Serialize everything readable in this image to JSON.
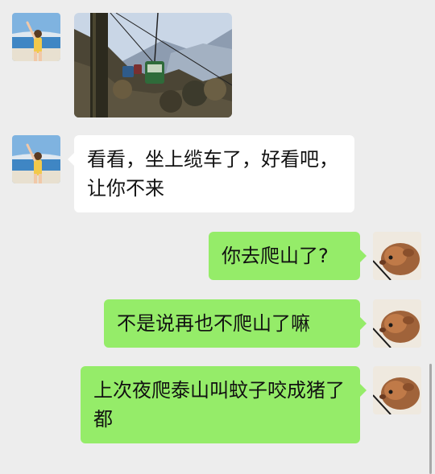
{
  "messages": [
    {
      "sender": "friend",
      "type": "image",
      "avatar": "girl-beach-avatar",
      "image": "cable-car-photo"
    },
    {
      "sender": "friend",
      "type": "text",
      "avatar": "girl-beach-avatar",
      "text": "看看，坐上缆车了，好看吧，让你不来"
    },
    {
      "sender": "me",
      "type": "text",
      "avatar": "guinea-pig-avatar",
      "text": "你去爬山了?"
    },
    {
      "sender": "me",
      "type": "text",
      "avatar": "guinea-pig-avatar",
      "text": "不是说再也不爬山了嘛"
    },
    {
      "sender": "me",
      "type": "text",
      "avatar": "guinea-pig-avatar",
      "text": "上次夜爬泰山叫蚊子咬成猪了都"
    }
  ],
  "colors": {
    "background": "#ededed",
    "incoming_bubble": "#ffffff",
    "outgoing_bubble": "#95ec69"
  }
}
